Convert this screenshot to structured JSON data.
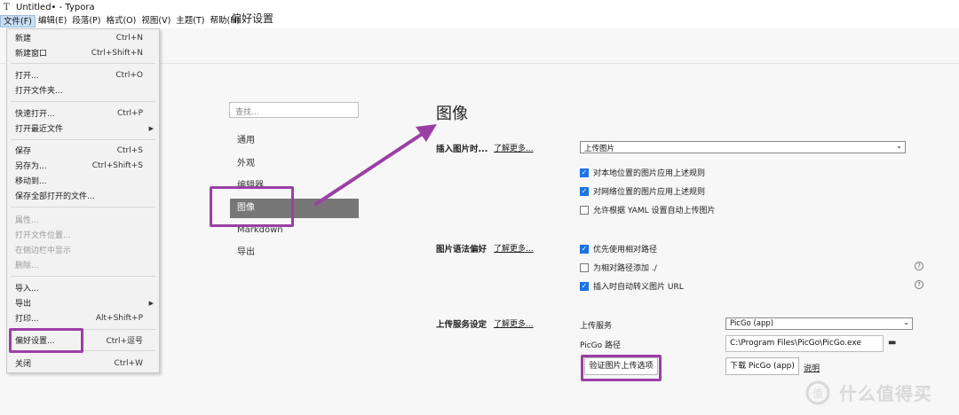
{
  "window": {
    "title": "Untitled• - Typora",
    "app_icon": "T"
  },
  "menubar": [
    "文件(F)",
    "编辑(E)",
    "段落(P)",
    "格式(O)",
    "视图(V)",
    "主题(T)",
    "帮助(H)"
  ],
  "header": {
    "title": "偏好设置"
  },
  "file_menu": {
    "items": [
      {
        "label": "新建",
        "shortcut": "Ctrl+N"
      },
      {
        "label": "新建窗口",
        "shortcut": "Ctrl+Shift+N"
      },
      {
        "label": "打开...",
        "shortcut": "Ctrl+O"
      },
      {
        "label": "打开文件夹...",
        "shortcut": ""
      },
      {
        "label": "快速打开...",
        "shortcut": "Ctrl+P"
      },
      {
        "label": "打开最近文件",
        "shortcut": "",
        "submenu": true
      },
      {
        "label": "保存",
        "shortcut": "Ctrl+S"
      },
      {
        "label": "另存为...",
        "shortcut": "Ctrl+Shift+S"
      },
      {
        "label": "移动到...",
        "shortcut": ""
      },
      {
        "label": "保存全部打开的文件...",
        "shortcut": ""
      },
      {
        "label": "属性...",
        "shortcut": "",
        "disabled": true
      },
      {
        "label": "打开文件位置...",
        "shortcut": "",
        "disabled": true
      },
      {
        "label": "在侧边栏中显示",
        "shortcut": "",
        "disabled": true
      },
      {
        "label": "删除...",
        "shortcut": "",
        "disabled": true
      },
      {
        "label": "导入...",
        "shortcut": ""
      },
      {
        "label": "导出",
        "shortcut": "",
        "submenu": true
      },
      {
        "label": "打印...",
        "shortcut": "Alt+Shift+P"
      },
      {
        "label": "偏好设置...",
        "shortcut": "Ctrl+逗号"
      },
      {
        "label": "关闭",
        "shortcut": "Ctrl+W"
      }
    ]
  },
  "settings_nav": {
    "search_placeholder": "查找...",
    "items": [
      "通用",
      "外观",
      "编辑器",
      "图像",
      "Markdown",
      "导出"
    ],
    "selected": "图像"
  },
  "image_section": {
    "title": "图像",
    "learn_more": "了解更多...",
    "insert": {
      "label": "插入图片时...",
      "select_value": "上传图片",
      "options": [
        {
          "label": "对本地位置的图片应用上述规则",
          "checked": true
        },
        {
          "label": "对网络位置的图片应用上述规则",
          "checked": true
        },
        {
          "label": "允许根据 YAML 设置自动上传图片",
          "checked": false
        }
      ]
    },
    "syntax": {
      "label": "图片语法偏好",
      "options": [
        {
          "label": "优先使用相对路径",
          "checked": true
        },
        {
          "label": "为相对路径添加 ./",
          "checked": false
        },
        {
          "label": "插入时自动转义图片 URL",
          "checked": true
        }
      ]
    },
    "upload": {
      "label": "上传服务设定",
      "service_label": "上传服务",
      "service_value": "PicGo (app)",
      "path_label": "PicGo 路径",
      "path_value": "C:\\Program Files\\PicGo\\PicGo.exe",
      "verify_button": "验证图片上传选项",
      "download_button": "下载 PicGo (app)",
      "explain_link": "说明"
    }
  },
  "watermark": {
    "text": "什么值得买",
    "icon": "值"
  },
  "colors": {
    "highlight": "#9b3fa5",
    "checkbox": "#1a73e8",
    "nav_selected": "#777777"
  }
}
